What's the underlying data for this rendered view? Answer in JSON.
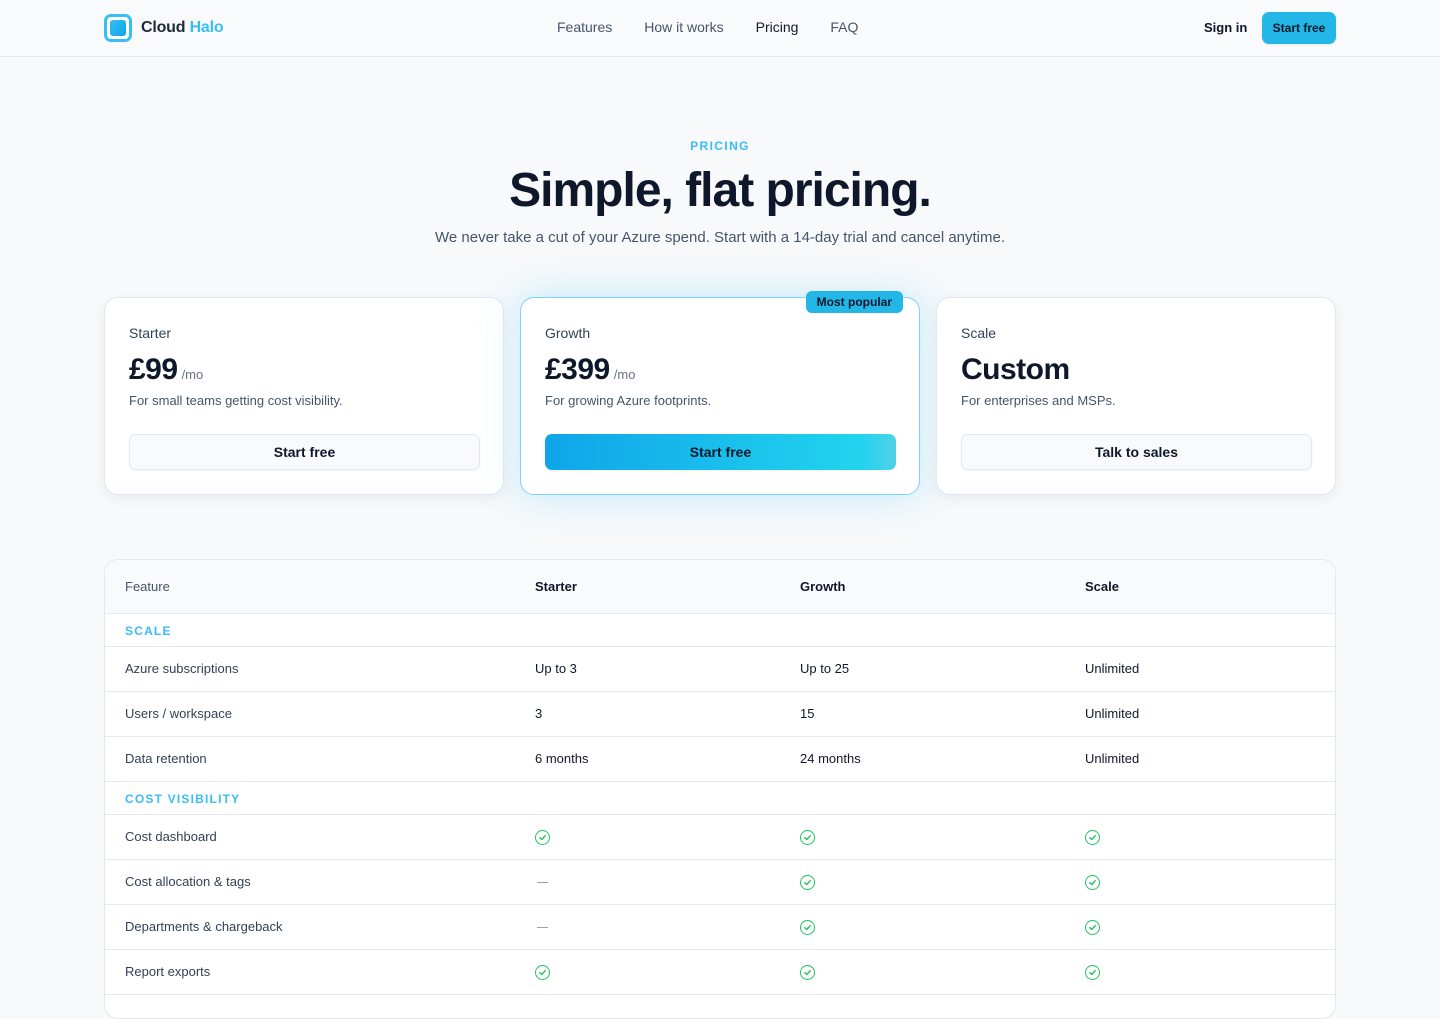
{
  "brand": {
    "name_part1": "Cloud",
    "name_part2": "Halo"
  },
  "nav": {
    "items": [
      "Features",
      "How it works",
      "Pricing",
      "FAQ"
    ],
    "active": "Pricing"
  },
  "header_actions": {
    "signin": "Sign in",
    "start": "Start free"
  },
  "hero": {
    "eyebrow": "PRICING",
    "title": "Simple, flat pricing.",
    "subtitle": "We never take a cut of your Azure spend. Start with a 14-day trial and cancel anytime."
  },
  "plans": [
    {
      "name": "Starter",
      "amount": "£99",
      "per": "/mo",
      "desc": "For small teams getting cost visibility.",
      "cta": "Start free",
      "featured": false
    },
    {
      "name": "Growth",
      "amount": "£399",
      "per": "/mo",
      "desc": "For growing Azure footprints.",
      "cta": "Start free",
      "featured": true,
      "badge": "Most popular"
    },
    {
      "name": "Scale",
      "amount": "Custom",
      "per": "",
      "desc": "For enterprises and MSPs.",
      "cta": "Talk to sales",
      "featured": false
    }
  ],
  "table": {
    "headers": [
      "Feature",
      "Starter",
      "Growth",
      "Scale"
    ],
    "sections": [
      {
        "title": "SCALE",
        "rows": [
          {
            "feature": "Azure subscriptions",
            "values": [
              "Up to 3",
              "Up to 25",
              "Unlimited"
            ]
          },
          {
            "feature": "Users / workspace",
            "values": [
              "3",
              "15",
              "Unlimited"
            ]
          },
          {
            "feature": "Data retention",
            "values": [
              "6 months",
              "24 months",
              "Unlimited"
            ]
          }
        ]
      },
      {
        "title": "COST VISIBILITY",
        "rows": [
          {
            "feature": "Cost dashboard",
            "values": [
              "check",
              "check",
              "check"
            ]
          },
          {
            "feature": "Cost allocation & tags",
            "values": [
              "dash",
              "check",
              "check"
            ]
          },
          {
            "feature": "Departments & chargeback",
            "values": [
              "dash",
              "check",
              "check"
            ]
          },
          {
            "feature": "Report exports",
            "values": [
              "check",
              "check",
              "check"
            ]
          }
        ]
      }
    ]
  },
  "colors": {
    "accent": "#38bdf8",
    "check": "#22c55e",
    "primary_button": "#22b7e6"
  }
}
